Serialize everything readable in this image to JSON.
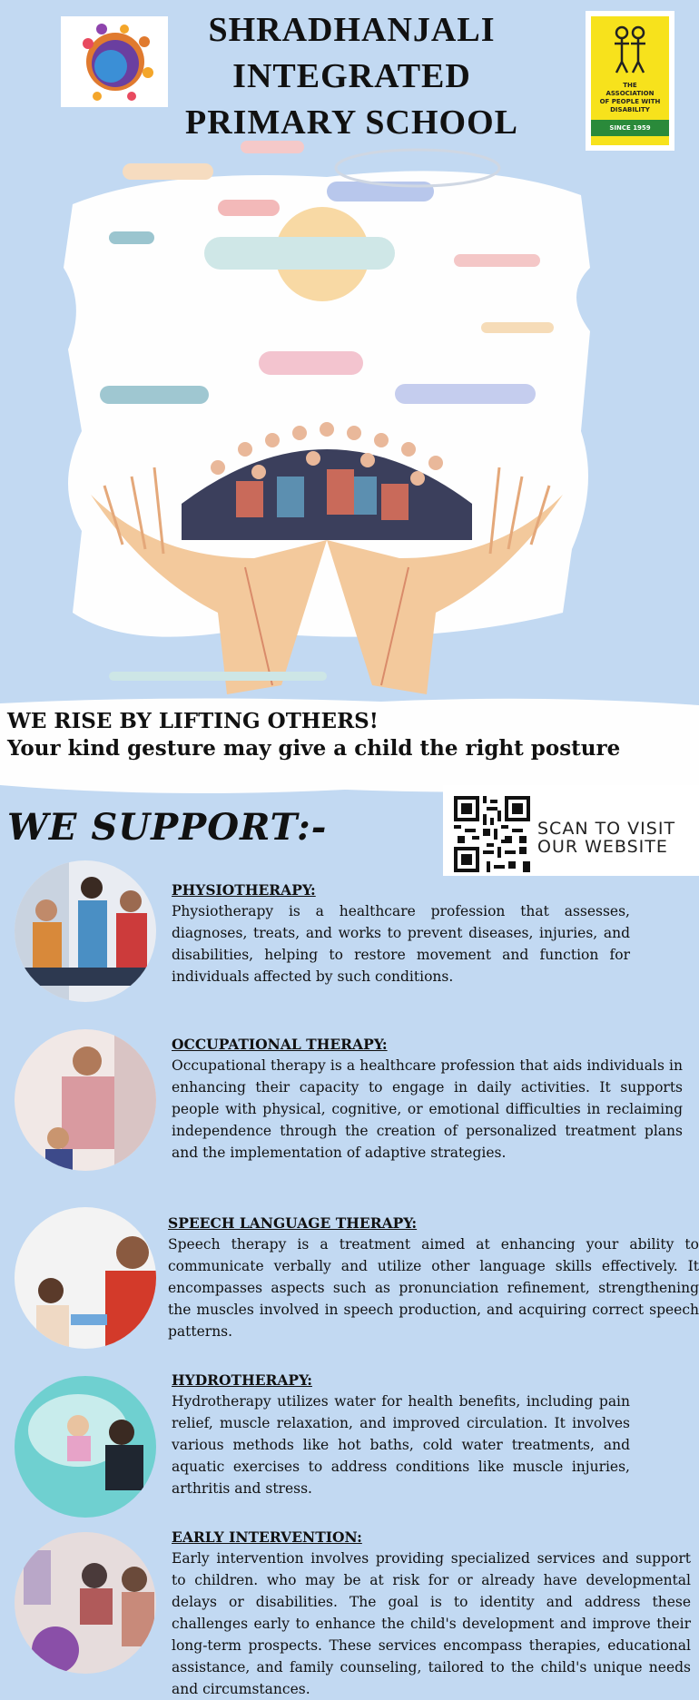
{
  "header": {
    "title_lines": [
      "SHRADHANJALI",
      "INTEGRATED",
      "PRIMARY SCHOOL"
    ],
    "partner_logo_text": [
      "THE",
      "ASSOCIATION",
      "OF PEOPLE WITH",
      "DISABILITY"
    ],
    "partner_since": "SINCE 1959",
    "left_logo_icon": "colorful-people-globe-icon",
    "partner_logo_icon": "people-figures-icon"
  },
  "hero": {
    "illustration": "hands-lifting-crowd-illustration"
  },
  "tagline": {
    "line1": "WE RISE BY LIFTING OTHERS!",
    "line2": "Your kind gesture may give a child the right posture"
  },
  "support_heading": "WE SUPPORT:-",
  "qr": {
    "line1": "SCAN TO VISIT",
    "line2": "OUR  WEBSITE"
  },
  "services": [
    {
      "title": "PHYSIOTHERAPY:",
      "body": "Physiotherapy is a healthcare profession that assesses, diagnoses, treats, and works to prevent diseases, injuries, and disabilities, helping to restore movement and function for individuals affected by such conditions."
    },
    {
      "title": "OCCUPATIONAL THERAPY:",
      "body": "Occupational therapy is a healthcare profession that aids individuals in enhancing their capacity to engage in daily activities. It supports people with physical, cognitive, or emotional difficulties in reclaiming independence through the creation of personalized treatment plans and the implementation of adaptive strategies."
    },
    {
      "title": "SPEECH LANGUAGE THERAPY:",
      "body": "Speech therapy is a treatment aimed at enhancing your ability to communicate verbally and utilize other language skills effectively. It encompasses aspects such as pronunciation refinement, strengthening the muscles involved in speech production, and acquiring correct speech patterns."
    },
    {
      "title": "HYDROTHERAPY:",
      "body": "Hydrotherapy utilizes water for health benefits, including pain relief, muscle relaxation, and improved circulation. It involves various methods like hot baths, cold water treatments, and aquatic exercises to address conditions like muscle injuries, arthritis and stress."
    },
    {
      "title": "EARLY INTERVENTION:",
      "body": "Early intervention involves providing specialized services and support to children. who may be at risk for or already have developmental delays or disabilities. The goal is to identity and address these challenges early to enhance the child's development and improve their long-term prospects. These services encompass therapies, educational assistance, and family counseling, tailored to the child's unique needs and circumstances."
    }
  ]
}
